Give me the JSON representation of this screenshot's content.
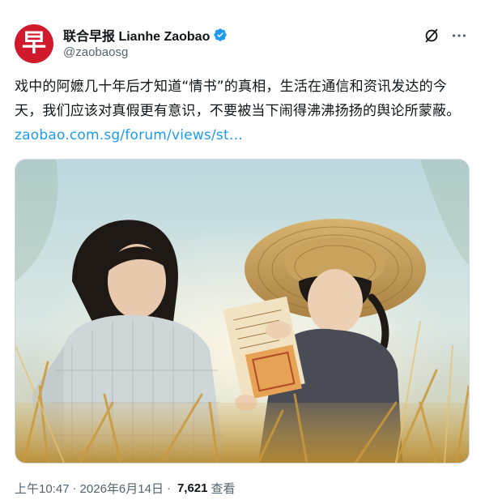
{
  "account": {
    "avatar_glyph": "早",
    "display_name": "联合早报 Lianhe Zaobao",
    "handle": "@zaobaosg",
    "brand_color": "#d01a2c",
    "verified_icon": "verified-badge-icon"
  },
  "toolbar": {
    "grok_icon": "grok-slash-icon",
    "more_icon": "more-dots-icon"
  },
  "tweet": {
    "text": "戏中的阿嬷几十年后才知道“情书”的真相，生活在通信和资讯发达的今天，我们应该对真假更有意识，不要被当下闹得沸沸扬扬的舆论所蒙蔽。",
    "link_text": "zaobao.com.sg/forum/views/st…",
    "link_color": "#1d9bf0"
  },
  "media": {
    "description_icon": "photo-two-women-reading-letter-in-field"
  },
  "meta": {
    "time": "上午10:47",
    "separator": "·",
    "date": "2026年6月14日",
    "views_count": "7,621",
    "views_label": "查看"
  }
}
